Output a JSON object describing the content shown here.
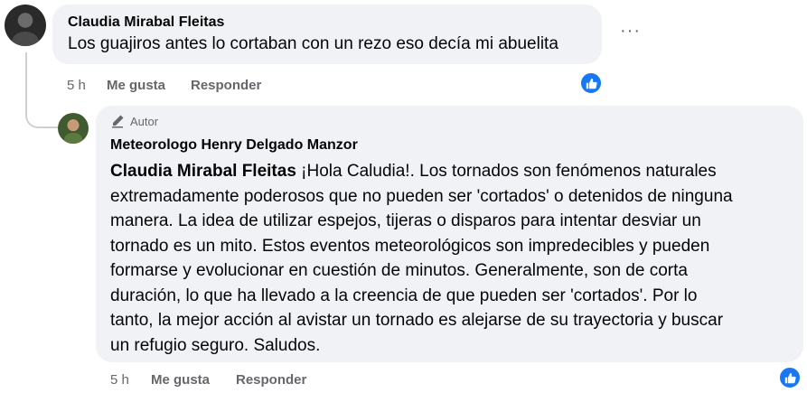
{
  "comment": {
    "author": "Claudia Mirabal Fleitas",
    "text": "Los guajiros antes lo cortaban con un rezo eso decía mi abuelita",
    "more": "···",
    "time": "5 h",
    "like_label": "Me gusta",
    "reply_label": "Responder"
  },
  "reply": {
    "badge": "Autor",
    "author": "Meteorologo Henry Delgado Manzor",
    "mention": "Claudia Mirabal Fleitas",
    "lines": [
      " ¡Hola Caludia!. Los tornados son fenómenos naturales",
      "extremadamente poderosos que no pueden ser 'cortados' o detenidos de ninguna",
      "manera. La idea de utilizar espejos, tijeras o disparos para intentar desviar un",
      "tornado es un mito. Estos eventos meteorológicos son impredecibles y pueden",
      "formarse y evolucionar en cuestión de minutos. Generalmente, son de corta",
      "duración, lo que ha llevado a la creencia de que pueden ser 'cortados'. Por lo",
      "tanto, la mejor acción al avistar un tornado es alejarse de su trayectoria y buscar",
      "un refugio seguro. Saludos."
    ],
    "time": "5 h",
    "like_label": "Me gusta",
    "reply_label": "Responder"
  },
  "colors": {
    "bubble": "#f0f2f5",
    "meta": "#65676b",
    "like_blue": "#1877f2",
    "thread_line": "#ced0d4"
  },
  "icons": [
    "avatar",
    "pencil-icon",
    "like-icon",
    "more-icon"
  ]
}
